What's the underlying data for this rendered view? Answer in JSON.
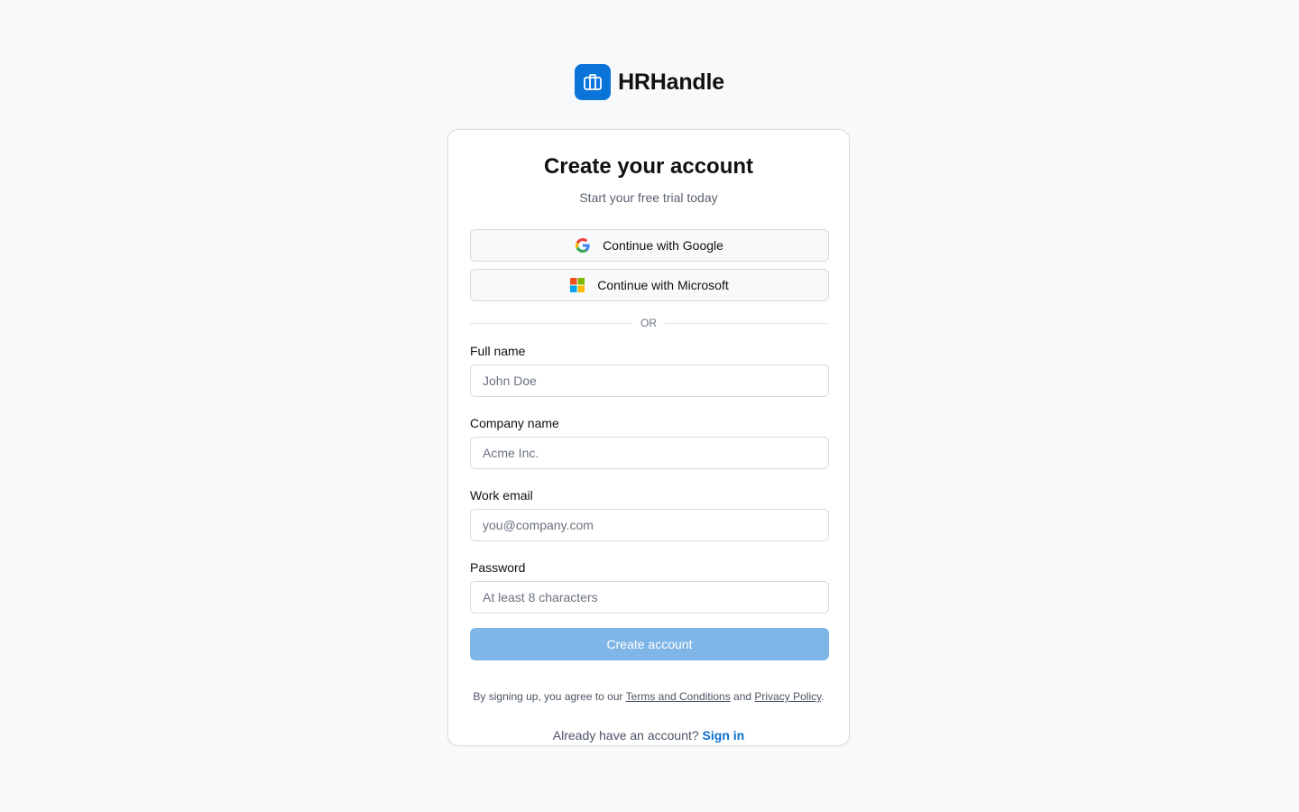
{
  "brand": {
    "name": "HRHandle",
    "logo_icon": "briefcase-icon",
    "logo_color": "#0a74d9"
  },
  "card": {
    "title": "Create your account",
    "subtitle": "Start your free trial today"
  },
  "oauth": {
    "google_label": "Continue with Google",
    "microsoft_label": "Continue with Microsoft"
  },
  "divider": {
    "text": "OR"
  },
  "form": {
    "full_name": {
      "label": "Full name",
      "placeholder": "John Doe",
      "value": ""
    },
    "company_name": {
      "label": "Company name",
      "placeholder": "Acme Inc.",
      "value": ""
    },
    "work_email": {
      "label": "Work email",
      "placeholder": "you@company.com",
      "value": ""
    },
    "password": {
      "label": "Password",
      "placeholder": "At least 8 characters",
      "value": ""
    },
    "submit_label": "Create account",
    "submit_color": "#7fb6e8"
  },
  "legal": {
    "prefix": "By signing up, you agree to our ",
    "terms_link": "Terms and Conditions",
    "middle": " and ",
    "privacy_link": "Privacy Policy",
    "suffix": "."
  },
  "signin": {
    "prompt": "Already have an account? ",
    "link": "Sign in",
    "link_color": "#0a6fcf"
  }
}
